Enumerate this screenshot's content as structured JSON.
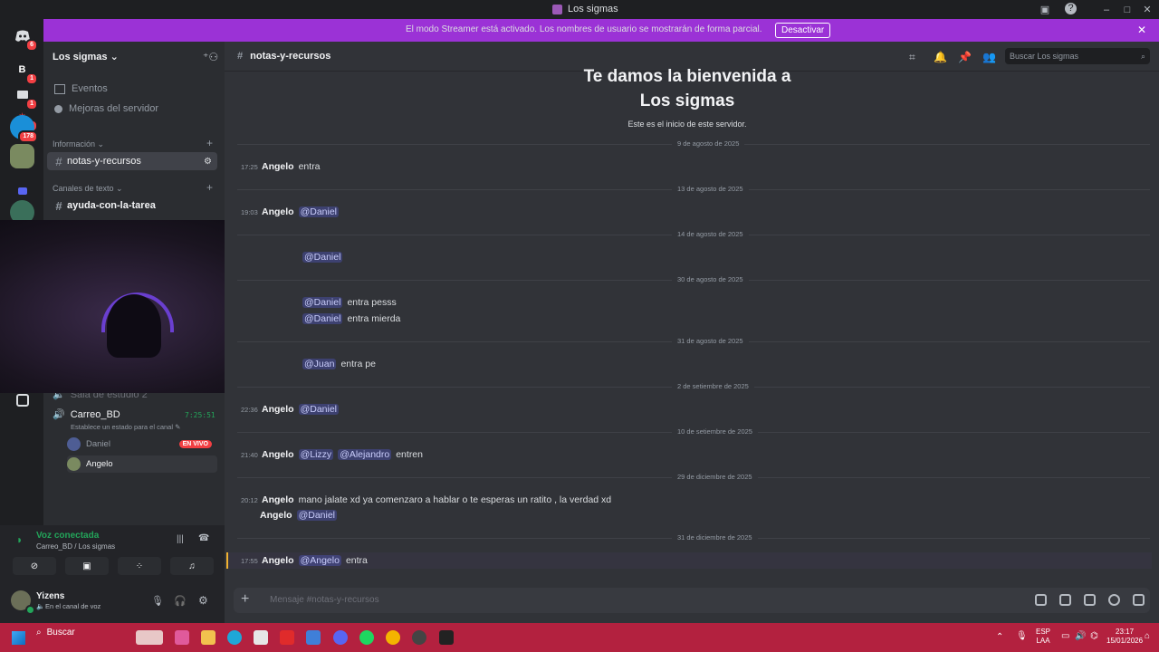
{
  "window": {
    "title": "Los sigmas"
  },
  "banner": {
    "message": "El modo Streamer está activado. Los nombres de usuario se mostrarán de forma parcial.",
    "button": "Desactivar"
  },
  "rail": {
    "servers": [
      {
        "label": "",
        "badge": "6"
      },
      {
        "label": "B",
        "badge": "1"
      },
      {
        "label": "",
        "badge": "1"
      },
      {
        "label": "",
        "badge": "1"
      },
      {
        "label": "",
        "badge": "178"
      },
      {
        "label": "",
        "badge": ""
      },
      {
        "label": "",
        "badge": ""
      },
      {
        "label": "",
        "badge": ""
      }
    ]
  },
  "sidebar": {
    "server_name": "Los sigmas",
    "events": "Eventos",
    "boosts": "Mejoras del servidor",
    "category_info": "Información",
    "active_channel": "notas-y-recursos",
    "category_text": "Canales de texto",
    "channel_homework": "ayuda-con-la-tarea",
    "voice_partial": "Sala de estudio 2",
    "voice_channel": "Carreo_BD",
    "voice_timer": "7:25:51",
    "voice_status": "Establece un estado para el canal",
    "voice_users": [
      {
        "name": "Daniel",
        "live": "EN VIVO"
      },
      {
        "name": "Angelo",
        "live": ""
      }
    ]
  },
  "userpanel": {
    "voice_connected": "Voz conectada",
    "voice_location": "Carreo_BD / Los sigmas",
    "username": "Yizens",
    "status": "En el canal de voz"
  },
  "chat": {
    "channel": "notas-y-recursos",
    "search_placeholder": "Buscar Los sigmas",
    "welcome_line1": "Te damos la bienvenida a",
    "welcome_line2": "Los sigmas",
    "welcome_sub": "Este es el inicio de este servidor.",
    "composer_placeholder": "Mensaje #notas-y-recursos",
    "dates": [
      "9 de agosto de 2025",
      "13 de agosto de 2025",
      "14 de agosto de 2025",
      "30 de agosto de 2025",
      "31 de agosto de 2025",
      "2 de setiembre de 2025",
      "10 de setiembre de 2025",
      "29 de diciembre de 2025",
      "31 de diciembre de 2025"
    ],
    "messages": [
      {
        "time": "17:25",
        "author": "Angelo",
        "text": "entra"
      },
      {
        "time": "19:03",
        "author": "Angelo",
        "mention": "@Daniel"
      },
      {
        "mention": "@Daniel"
      },
      {
        "mention": "@Daniel",
        "text": "entra pesss"
      },
      {
        "mention": "@Daniel",
        "text": "entra mierda"
      },
      {
        "mention": "@Juan",
        "text": "entra pe"
      },
      {
        "time": "22:36",
        "author": "Angelo",
        "mention": "@Daniel"
      },
      {
        "time": "21:40",
        "author": "Angelo",
        "mention": "@Lizzy",
        "mention2": "@Alejandro",
        "text": "entren"
      },
      {
        "time": "20:12",
        "author": "Angelo",
        "text": "mano jalate xd ya comenzaro a hablar o te esperas un ratito , la verdad xd"
      },
      {
        "author": "Angelo",
        "mention": "@Daniel"
      },
      {
        "time": "17:55",
        "author": "Angelo",
        "mention": "@Angelo",
        "text": "entra"
      }
    ]
  },
  "taskbar": {
    "search": "Buscar",
    "lang1": "ESP",
    "lang2": "LAA",
    "time": "23:17",
    "date": "15/01/2026"
  },
  "colors": {
    "accent": "#5865f2",
    "banner": "#9b32d6",
    "taskbar": "#b3213f",
    "online": "#23a55a",
    "live": "#f23f43"
  }
}
